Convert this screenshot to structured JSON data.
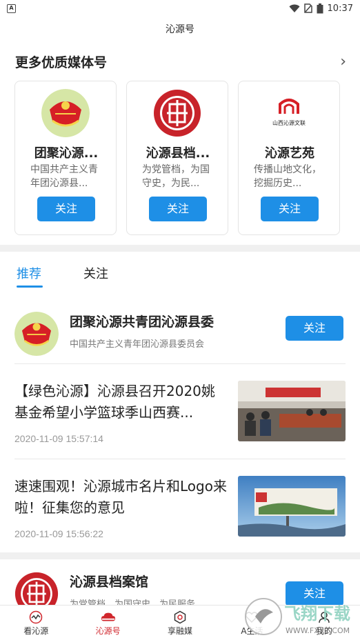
{
  "status": {
    "time": "10:37",
    "app_badge": "A"
  },
  "header": {
    "title": "沁源号"
  },
  "media": {
    "section_title": "更多优质媒体号",
    "cards": [
      {
        "name": "团聚沁源...",
        "desc": "中国共产主义青年团沁源县...",
        "button": "关注"
      },
      {
        "name": "沁源县档...",
        "desc": "为党管档，为国守史，为民...",
        "button": "关注"
      },
      {
        "name": "沁源艺苑",
        "desc": "传播山地文化，挖掘历史...",
        "button": "关注"
      }
    ],
    "card3_logo_text": "山西沁源文联"
  },
  "tabs": [
    {
      "label": "推荐"
    },
    {
      "label": "关注"
    }
  ],
  "accounts": [
    {
      "name": "团聚沁源共青团沁源县委",
      "desc": "中国共产主义青年团沁源县委员会",
      "button": "关注"
    },
    {
      "name": "沁源县档案馆",
      "desc": "为党管档，为国守史，为民服务",
      "button": "关注"
    }
  ],
  "news": [
    {
      "title": "【绿色沁源】沁源县召开2020姚基金希望小学篮球季山西赛...",
      "time": "2020-11-09 15:57:14"
    },
    {
      "title": "速速围观！沁源城市名片和Logo来啦！征集您的意见",
      "time": "2020-11-09 15:56:22"
    }
  ],
  "bottom_nav": [
    {
      "label": "看沁源",
      "icon": "wave-icon"
    },
    {
      "label": "沁源号",
      "icon": "cloud-icon"
    },
    {
      "label": "享融媒",
      "icon": "hexagon-icon"
    },
    {
      "label": "A生活",
      "icon": "heart-icon"
    },
    {
      "label": "我的",
      "icon": "user-icon"
    }
  ],
  "watermark": {
    "text": "飞翔下载",
    "url": "WWW.FXXZ.COM"
  },
  "colors": {
    "accent": "#1e8fe6",
    "nav_active": "#d0262c"
  }
}
